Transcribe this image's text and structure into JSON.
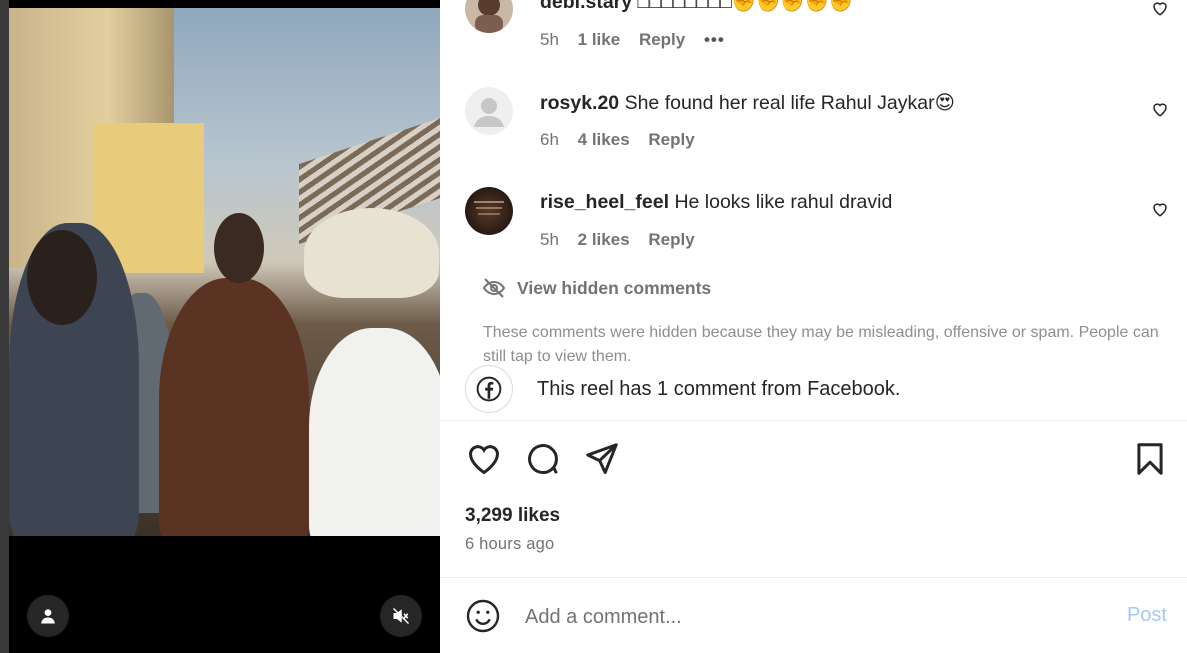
{
  "comments": [
    {
      "username": "debi.stary",
      "text": "□□□□□□□□✊✊✊✊✊",
      "time": "5h",
      "likes": "1 like",
      "reply": "Reply",
      "more": "•••"
    },
    {
      "username": "rosyk.20",
      "text": "She found her real life Rahul Jaykar😍",
      "time": "6h",
      "likes": "4 likes",
      "reply": "Reply"
    },
    {
      "username": "rise_heel_feel",
      "text": "He looks like rahul dravid",
      "time": "5h",
      "likes": "2 likes",
      "reply": "Reply"
    }
  ],
  "hidden": {
    "label": "View hidden comments",
    "note": "These comments were hidden because they may be misleading, offensive or spam. People can still tap to view them."
  },
  "facebook": {
    "text": "This reel has 1 comment from Facebook."
  },
  "post": {
    "likes": "3,299 likes",
    "time_ago": "6 hours ago"
  },
  "composer": {
    "placeholder": "Add a comment...",
    "post_label": "Post"
  },
  "colors": {
    "post_button": "#a5c8f4",
    "meta_text": "#737373",
    "heart_outline": "#262626"
  },
  "icons": [
    "heart-icon",
    "comment-icon",
    "share-icon",
    "bookmark-icon",
    "emoji-icon",
    "facebook-icon",
    "eye-off-icon",
    "mute-icon",
    "user-icon"
  ]
}
